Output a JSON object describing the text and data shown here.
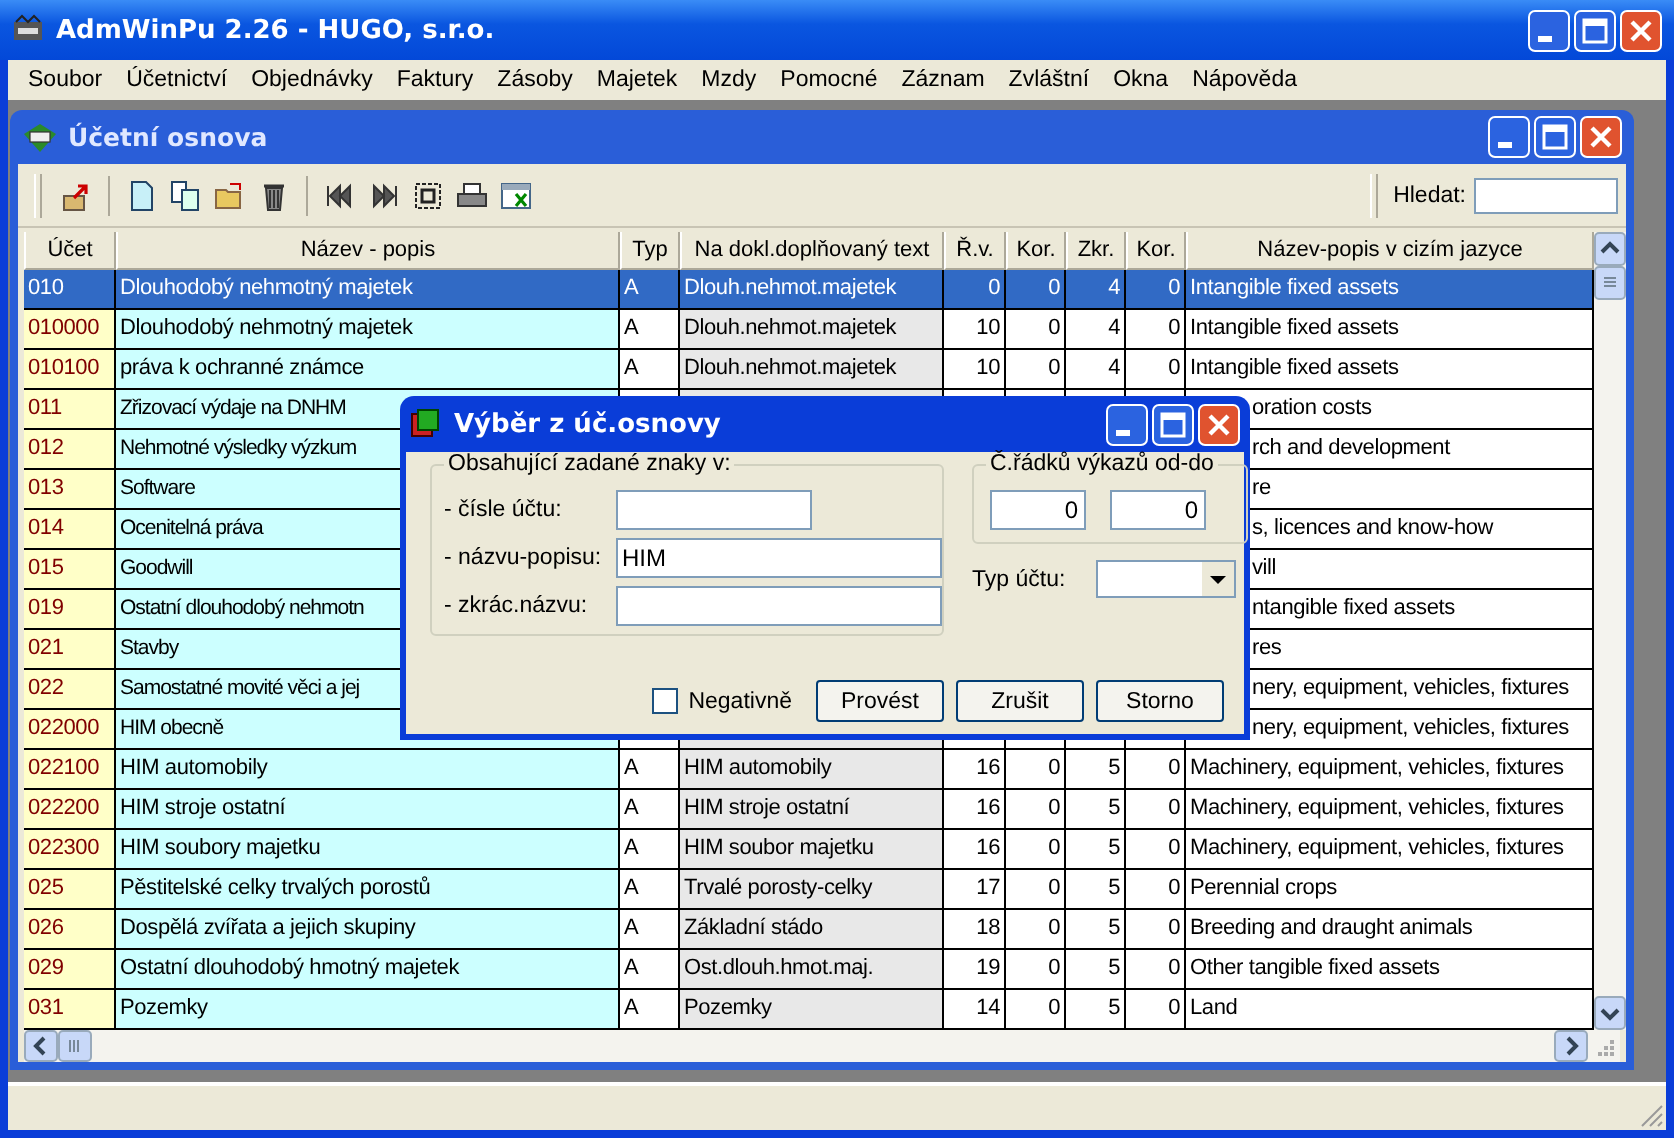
{
  "app": {
    "title": "AdmWinPu 2.26 - HUGO, s.r.o."
  },
  "menu": [
    "Soubor",
    "Účetnictví",
    "Objednávky",
    "Faktury",
    "Zásoby",
    "Majetek",
    "Mzdy",
    "Pomocné",
    "Záznam",
    "Zvláštní",
    "Okna",
    "Nápověda"
  ],
  "child_window": {
    "title": "Účetní osnova",
    "search": {
      "label": "Hledat:"
    },
    "table": {
      "columns": [
        "Účet",
        "Název - popis",
        "Typ",
        "Na dokl.doplňovaný text",
        "Ř.v.",
        "Kor.",
        "Zkr.",
        "Kor.",
        "Název-popis v cizím jazyce"
      ],
      "rows": [
        {
          "selected": true,
          "covered": false,
          "cells": [
            "010",
            "Dlouhodobý nehmotný majetek",
            "A",
            "Dlouh.nehmot.majetek",
            "0",
            "0",
            "4",
            "0",
            "Intangible fixed assets"
          ]
        },
        {
          "selected": false,
          "covered": false,
          "cells": [
            "010000",
            "Dlouhodobý nehmotný majetek",
            "A",
            "Dlouh.nehmot.majetek",
            "10",
            "0",
            "4",
            "0",
            "Intangible fixed assets"
          ]
        },
        {
          "selected": false,
          "covered": false,
          "cells": [
            "010100",
            "práva k ochranné známce",
            "A",
            "Dlouh.nehmot.majetek",
            "10",
            "0",
            "4",
            "0",
            "Intangible fixed assets"
          ]
        },
        {
          "selected": false,
          "covered": true,
          "cells": [
            "011",
            "Zřizovací výdaje na DNHM",
            "oration costs"
          ]
        },
        {
          "selected": false,
          "covered": true,
          "cells": [
            "012",
            "Nehmotné výsledky výzkum",
            "rch and development"
          ]
        },
        {
          "selected": false,
          "covered": true,
          "cells": [
            "013",
            "Software",
            "re"
          ]
        },
        {
          "selected": false,
          "covered": true,
          "cells": [
            "014",
            "Ocenitelná práva",
            "s, licences and know-how"
          ]
        },
        {
          "selected": false,
          "covered": true,
          "cells": [
            "015",
            "Goodwill",
            "vill"
          ]
        },
        {
          "selected": false,
          "covered": true,
          "cells": [
            "019",
            "Ostatní dlouhodobý nehmotn",
            "ntangible fixed assets"
          ]
        },
        {
          "selected": false,
          "covered": true,
          "cells": [
            "021",
            "Stavby",
            "res"
          ]
        },
        {
          "selected": false,
          "covered": true,
          "cells": [
            "022",
            "Samostatné movité věci a jej",
            "nery, equipment, vehicles, fixtures"
          ]
        },
        {
          "selected": false,
          "covered": true,
          "cells": [
            "022000",
            "HIM  obecně",
            "nery, equipment, vehicles, fixtures"
          ]
        },
        {
          "selected": false,
          "covered": false,
          "cells": [
            "022100",
            "HIM automobily",
            "A",
            "HIM automobily",
            "16",
            "0",
            "5",
            "0",
            "Machinery, equipment, vehicles, fixtures"
          ]
        },
        {
          "selected": false,
          "covered": false,
          "cells": [
            "022200",
            "HIM stroje ostatní",
            "A",
            "HIM stroje ostatní",
            "16",
            "0",
            "5",
            "0",
            "Machinery, equipment, vehicles, fixtures"
          ]
        },
        {
          "selected": false,
          "covered": false,
          "cells": [
            "022300",
            "HIM soubory majetku",
            "A",
            "HIM soubor majetku",
            "16",
            "0",
            "5",
            "0",
            "Machinery, equipment, vehicles, fixtures"
          ]
        },
        {
          "selected": false,
          "covered": false,
          "cells": [
            "025",
            "Pěstitelské celky trvalých porostů",
            "A",
            "Trvalé porosty-celky",
            "17",
            "0",
            "5",
            "0",
            "Perennial crops"
          ]
        },
        {
          "selected": false,
          "covered": false,
          "cells": [
            "026",
            "Dospělá zvířata a jejich skupiny",
            "A",
            "Základní stádo",
            "18",
            "0",
            "5",
            "0",
            "Breeding and draught animals"
          ]
        },
        {
          "selected": false,
          "covered": false,
          "cells": [
            "029",
            "Ostatní dlouhodobý hmotný majetek",
            "A",
            "Ost.dlouh.hmot.maj.",
            "19",
            "0",
            "5",
            "0",
            "Other tangible fixed assets"
          ]
        },
        {
          "selected": false,
          "covered": false,
          "cells": [
            "031",
            "Pozemky",
            "A",
            "Pozemky",
            "14",
            "0",
            "5",
            "0",
            "Land"
          ]
        }
      ]
    }
  },
  "dialog": {
    "title": "Výběr z úč.osnovy",
    "group": {
      "label": "Obsahující zadané znaky v:",
      "fields": [
        {
          "label": "- čísle účtu:"
        },
        {
          "label": "- názvu-popisu:",
          "value": "HIM"
        },
        {
          "label": "- zkrác.názvu:"
        }
      ]
    },
    "range": {
      "label": "Č.řádků výkazů od-do",
      "from": "0",
      "to": "0"
    },
    "type": {
      "label": "Typ účtu:"
    },
    "negative": {
      "label": "Negativně",
      "checked": false
    },
    "buttons": [
      "Provést",
      "Zrušit",
      "Storno"
    ]
  }
}
